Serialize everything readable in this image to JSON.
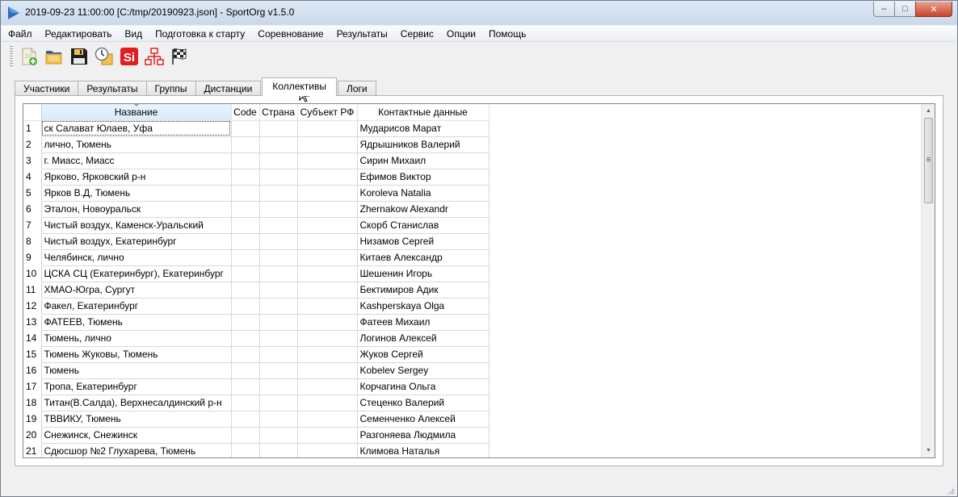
{
  "window": {
    "title": "2019-09-23 11:00:00 [C:/tmp/20190923.json] - SportOrg v1.5.0",
    "controls": {
      "minimize": "–",
      "maximize": "□",
      "close": "✕"
    }
  },
  "menu": {
    "items": [
      "Файл",
      "Редактировать",
      "Вид",
      "Подготовка к старту",
      "Соревнование",
      "Результаты",
      "Сервис",
      "Опции",
      "Помощь"
    ]
  },
  "toolbar": {
    "buttons": [
      {
        "icon": "new-file-icon"
      },
      {
        "icon": "open-folder-icon"
      },
      {
        "icon": "save-icon"
      },
      {
        "icon": "clock-icon"
      },
      {
        "icon": "si-reader-icon",
        "label": "Si"
      },
      {
        "icon": "network-icon"
      },
      {
        "icon": "checkered-flag-icon"
      }
    ]
  },
  "tabs": [
    {
      "label": "Участники",
      "active": false
    },
    {
      "label": "Результаты",
      "active": false
    },
    {
      "label": "Группы",
      "active": false
    },
    {
      "label": "Дистанции",
      "active": false
    },
    {
      "label": "Коллективы",
      "active": true
    },
    {
      "label": "Логи",
      "active": false
    }
  ],
  "table": {
    "columns": [
      "Название",
      "Code",
      "Страна",
      "Субъект РФ",
      "Контактные данные"
    ],
    "sorted_column": "Название",
    "rows": [
      {
        "num": "1",
        "name": "ск Салават Юлаев, Уфа",
        "code": "",
        "country": "",
        "region": "",
        "contact": "Мударисов Марат"
      },
      {
        "num": "2",
        "name": "лично, Тюмень",
        "code": "",
        "country": "",
        "region": "",
        "contact": "Ядрышников Валерий"
      },
      {
        "num": "3",
        "name": "г. Миасс, Миасс",
        "code": "",
        "country": "",
        "region": "",
        "contact": "Сирин Михаил"
      },
      {
        "num": "4",
        "name": "Ярково, Ярковский р-н",
        "code": "",
        "country": "",
        "region": "",
        "contact": "Ефимов Виктор"
      },
      {
        "num": "5",
        "name": "Ярков В.Д, Тюмень",
        "code": "",
        "country": "",
        "region": "",
        "contact": "Koroleva Natalia"
      },
      {
        "num": "6",
        "name": "Эталон, Новоуральск",
        "code": "",
        "country": "",
        "region": "",
        "contact": "Zhernakow Alexandr"
      },
      {
        "num": "7",
        "name": "Чистый воздух, Каменск-Уральский",
        "code": "",
        "country": "",
        "region": "",
        "contact": "Скорб Станислав"
      },
      {
        "num": "8",
        "name": "Чистый воздух, Екатеринбург",
        "code": "",
        "country": "",
        "region": "",
        "contact": "Низамов Сергей"
      },
      {
        "num": "9",
        "name": "Челябинск, лично",
        "code": "",
        "country": "",
        "region": "",
        "contact": "Китаев Александр"
      },
      {
        "num": "10",
        "name": "ЦСКА СЦ (Екатеринбург), Екатеринбург",
        "code": "",
        "country": "",
        "region": "",
        "contact": "Шешенин Игорь"
      },
      {
        "num": "11",
        "name": "ХМАО-Югра, Сургут",
        "code": "",
        "country": "",
        "region": "",
        "contact": "Бектимиров Адик"
      },
      {
        "num": "12",
        "name": "Факел, Екатеринбург",
        "code": "",
        "country": "",
        "region": "",
        "contact": "Kashperskaya Olga"
      },
      {
        "num": "13",
        "name": "ФАТЕЕВ, Тюмень",
        "code": "",
        "country": "",
        "region": "",
        "contact": "Фатеев Михаил"
      },
      {
        "num": "14",
        "name": "Тюмень, лично",
        "code": "",
        "country": "",
        "region": "",
        "contact": "Логинов Алексей"
      },
      {
        "num": "15",
        "name": "Тюмень Жуковы, Тюмень",
        "code": "",
        "country": "",
        "region": "",
        "contact": "Жуков Сергей"
      },
      {
        "num": "16",
        "name": "Тюмень",
        "code": "",
        "country": "",
        "region": "",
        "contact": "Kobelev Sergey"
      },
      {
        "num": "17",
        "name": "Тропа, Екатеринбург",
        "code": "",
        "country": "",
        "region": "",
        "contact": "Корчагина Ольга"
      },
      {
        "num": "18",
        "name": "Титан(В.Салда), Верхнесалдинский р-н",
        "code": "",
        "country": "",
        "region": "",
        "contact": "Стеценко Валерий"
      },
      {
        "num": "19",
        "name": "ТВВИКУ, Тюмень",
        "code": "",
        "country": "",
        "region": "",
        "contact": "Семенченко Алексей"
      },
      {
        "num": "20",
        "name": "Снежинск, Снежинск",
        "code": "",
        "country": "",
        "region": "",
        "contact": "Разгоняева Людмила"
      },
      {
        "num": "21",
        "name": "Сдюсшор №2 Глухарева, Тюмень",
        "code": "",
        "country": "",
        "region": "",
        "contact": "Климова Наталья"
      }
    ]
  },
  "colors": {
    "accent": "#3399ff",
    "si_red": "#e02020"
  }
}
